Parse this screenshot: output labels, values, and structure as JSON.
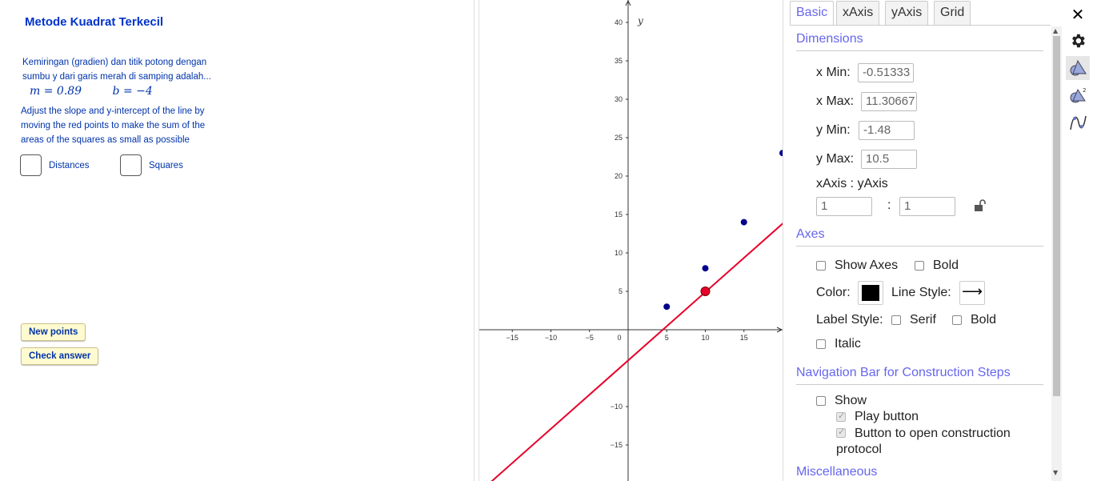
{
  "left": {
    "title": "Metode Kuadrat Terkecil",
    "description": "Kemiringan (gradien) dan titik potong dengan sumbu y dari garis merah di samping adalah...",
    "m_text": "m = 0.89",
    "b_text": "b = −4",
    "instruction": "Adjust the slope and y-intercept of the line by moving the red points to make the sum of the areas of the squares as small as possible",
    "checkbox_distances": "Distances",
    "checkbox_squares": "Squares",
    "btn_new_points": "New points",
    "btn_check_answer": "Check answer"
  },
  "graph": {
    "axis_y_label": "y",
    "x_ticks": [
      "−15",
      "−10",
      "−5",
      "0",
      "5",
      "10",
      "15"
    ],
    "y_ticks": [
      "40",
      "35",
      "30",
      "25",
      "20",
      "15",
      "10",
      "5",
      "−10",
      "−15"
    ],
    "points": [
      {
        "x": 5,
        "y": 3
      },
      {
        "x": 10,
        "y": 8
      },
      {
        "x": 15,
        "y": 14
      },
      {
        "x": 20,
        "y": 23
      }
    ],
    "red_point": {
      "x": 10,
      "y": 5
    },
    "line": {
      "slope": 0.89,
      "intercept": -4
    },
    "colors": {
      "points": "#00008b",
      "line": "#e8002a"
    }
  },
  "settings": {
    "tabs": [
      "Basic",
      "xAxis",
      "yAxis",
      "Grid"
    ],
    "active_tab": "Basic",
    "dimensions_title": "Dimensions",
    "x_min_label": "x Min:",
    "x_min_value": "-0.51333",
    "x_max_label": "x Max:",
    "x_max_value": "11.30667",
    "y_min_label": "y Min:",
    "y_min_value": "-1.48",
    "y_max_label": "y Max:",
    "y_max_value": "10.5",
    "ratio_label": "xAxis : yAxis",
    "ratio_x": "1",
    "ratio_sep": ":",
    "ratio_y": "1",
    "axes_title": "Axes",
    "show_axes_label": "Show Axes",
    "bold_label": "Bold",
    "color_label": "Color:",
    "line_style_label": "Line Style:",
    "line_style_glyph": "⟶",
    "label_style_label": "Label Style:",
    "serif_label": "Serif",
    "bold2_label": "Bold",
    "italic_label": "Italic",
    "nav_title": "Navigation Bar for Construction Steps",
    "show_label": "Show",
    "play_button_label": "Play button",
    "open_protocol_label": "Button to open construction protocol",
    "misc_title": "Miscellaneous"
  },
  "toolbar": {
    "close_glyph": "✕"
  }
}
